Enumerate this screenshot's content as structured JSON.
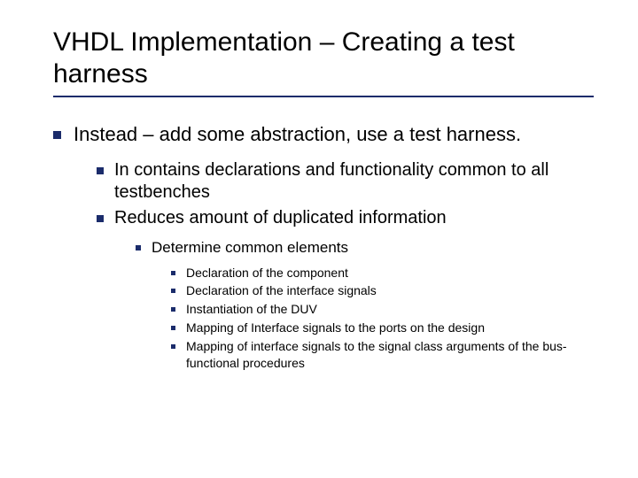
{
  "title": "VHDL Implementation – Creating a test harness",
  "bullets": {
    "lvl1": "Instead – add some abstraction, use a test harness.",
    "lvl2a": "In contains declarations and functionality common to all testbenches",
    "lvl2b": "Reduces amount of duplicated information",
    "lvl3": "Determine common elements",
    "lvl4a": "Declaration of the component",
    "lvl4b": "Declaration of the interface signals",
    "lvl4c": "Instantiation of the DUV",
    "lvl4d": "Mapping of Interface signals to the ports on the design",
    "lvl4e": "Mapping of interface signals to the signal class arguments of the bus-functional procedures"
  }
}
